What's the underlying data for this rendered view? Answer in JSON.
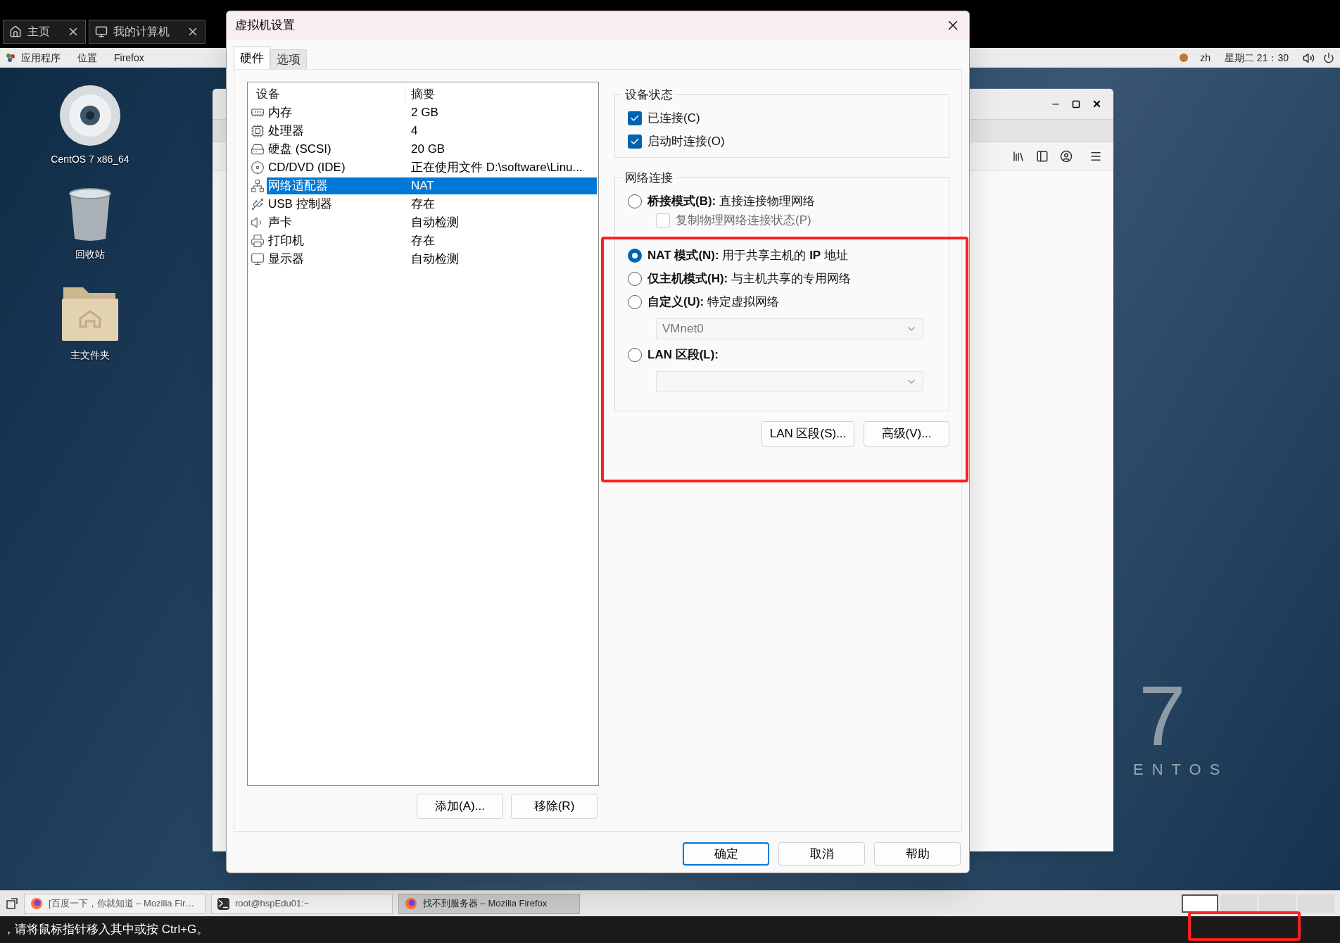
{
  "vmware_tabs": [
    {
      "label": "主页",
      "kind": "home",
      "selected": false
    },
    {
      "label": "我的计算机",
      "kind": "computer",
      "selected": false
    }
  ],
  "top_bar": {
    "menus": [
      "应用程序",
      "位置",
      "Firefox"
    ],
    "language": "zh",
    "clock": "星期二 21：30"
  },
  "desktop_icons": [
    {
      "kind": "disc",
      "label": "CentOS 7 x86_64"
    },
    {
      "kind": "trash",
      "label": "回收站"
    },
    {
      "kind": "folder",
      "label": "主文件夹"
    }
  ],
  "wallpaper": {
    "logo_number": "7",
    "logo_text": "ENTOS"
  },
  "dialog": {
    "title": "虚拟机设置",
    "tabs": [
      {
        "label": "硬件",
        "selected": true
      },
      {
        "label": "选项",
        "selected": false
      }
    ],
    "devices": {
      "columns": [
        "设备",
        "摘要"
      ],
      "rows": [
        {
          "kind": "memory",
          "device": "内存",
          "summary": "2 GB",
          "selected": false
        },
        {
          "kind": "cpu",
          "device": "处理器",
          "summary": "4",
          "selected": false
        },
        {
          "kind": "disk",
          "device": "硬盘 (SCSI)",
          "summary": "20 GB",
          "selected": false
        },
        {
          "kind": "cd",
          "device": "CD/DVD (IDE)",
          "summary": "正在使用文件 D:\\software\\Linu...",
          "selected": false
        },
        {
          "kind": "network",
          "device": "网络适配器",
          "summary": "NAT",
          "selected": true
        },
        {
          "kind": "usb",
          "device": "USB 控制器",
          "summary": "存在",
          "selected": false
        },
        {
          "kind": "sound",
          "device": "声卡",
          "summary": "自动检测",
          "selected": false
        },
        {
          "kind": "printer",
          "device": "打印机",
          "summary": "存在",
          "selected": false
        },
        {
          "kind": "display",
          "device": "显示器",
          "summary": "自动检测",
          "selected": false
        }
      ]
    },
    "device_buttons": [
      "添加(A)...",
      "移除(R)"
    ],
    "device_status": {
      "title": "设备状态",
      "options": [
        {
          "label": "已连接(C)",
          "checked": true
        },
        {
          "label": "启动时连接(O)",
          "checked": true
        }
      ]
    },
    "network": {
      "title": "网络连接",
      "items": [
        {
          "kind": "radio",
          "label": "**桥接模式(B):** 直接连接物理网络",
          "selected": false
        },
        {
          "kind": "checkbox",
          "label": "复制物理网络连接状态(P)",
          "checked": false,
          "disabled": true
        },
        {
          "kind": "radio",
          "label": "**NAT 模式(N):** 用于共享主机的 **IP** 地址",
          "selected": true
        },
        {
          "kind": "radio",
          "label": "**仅主机模式(H):** 与主机共享的专用网络",
          "selected": false
        },
        {
          "kind": "radio",
          "label": "**自定义(U):** 特定虚拟网络",
          "selected": false
        },
        {
          "kind": "select",
          "value": "VMnet0",
          "disabled": true
        },
        {
          "kind": "radio",
          "label": "**LAN 区段(L):**",
          "selected": false
        },
        {
          "kind": "select",
          "disabled": true
        }
      ]
    },
    "network_buttons": [
      "LAN 区段(S)...",
      "高级(V)..."
    ],
    "footer_buttons": [
      {
        "label": "确定",
        "default": true
      },
      {
        "label": "取消",
        "default": false
      },
      {
        "label": "帮助",
        "default": false
      }
    ]
  },
  "taskbar": {
    "windows": [
      {
        "kind": "firefox",
        "label": "[百度一下，你就知道 – Mozilla Fir…",
        "selected": false
      },
      {
        "kind": "terminal",
        "label": "root@hspEdu01:~",
        "selected": false
      },
      {
        "kind": "firefox",
        "label": "找不到服务器 – Mozilla Firefox",
        "selected": true
      }
    ]
  },
  "status_bar": {
    "message": "，请将鼠标指针移入其中或按 Ctrl+G。"
  }
}
